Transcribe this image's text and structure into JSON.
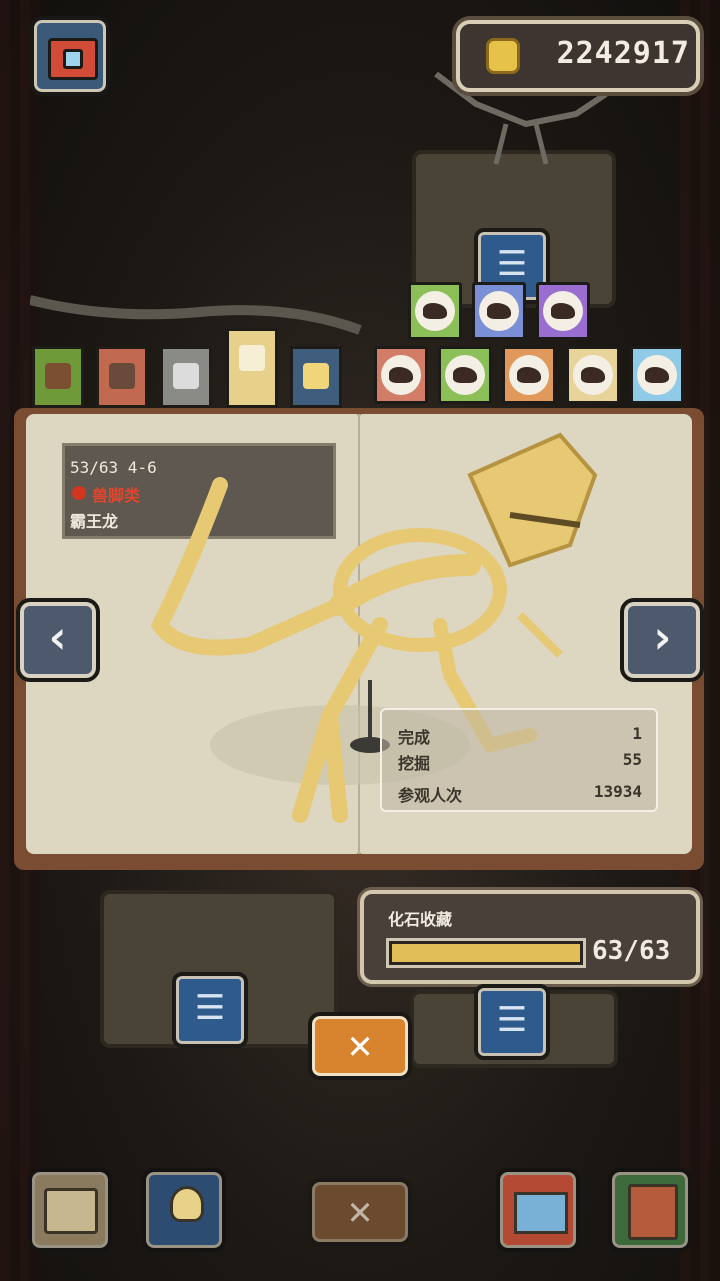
{
  "currency": {
    "amount": "2242917",
    "icon": "coin-icon"
  },
  "category_tabs": [
    {
      "name": "tab-wood",
      "color": "#6f9a3a",
      "inner": "#7a5030"
    },
    {
      "name": "tab-clay",
      "color": "#c26a50",
      "inner": "#6a4a3a"
    },
    {
      "name": "tab-stone",
      "color": "#8a8a86",
      "inner": "#dcdcdc"
    },
    {
      "name": "tab-gold",
      "color": "#e6d08a",
      "inner": "#f6efd6"
    },
    {
      "name": "tab-blue",
      "color": "#3f5e7e",
      "inner": "#f0d57a"
    }
  ],
  "dino_icons_top": [
    {
      "name": "sauropod-icon",
      "bg": "#8cbf58"
    },
    {
      "name": "plesiosaur-icon",
      "bg": "#7b8fd6"
    },
    {
      "name": "ammonite-icon",
      "bg": "#9a6ed0"
    }
  ],
  "dino_icons_bottom": [
    {
      "name": "theropod-icon",
      "bg": "#d17d68"
    },
    {
      "name": "ornithopod-icon",
      "bg": "#8cbf58"
    },
    {
      "name": "stegosaur-icon",
      "bg": "#e0995a"
    },
    {
      "name": "ceratopsian-icon",
      "bg": "#e8d49a"
    },
    {
      "name": "pterosaur-icon",
      "bg": "#8fcbe6"
    }
  ],
  "specimen": {
    "progress": "53/63  4-6",
    "category": "兽脚类",
    "name": "霸王龙"
  },
  "stats": {
    "completed_label": "完成",
    "completed_value": "1",
    "excavated_label": "挖掘",
    "excavated_value": "55",
    "visitors_label": "参观人次",
    "visitors_value": "13934"
  },
  "collection": {
    "title": "化石收藏",
    "count": "63/63",
    "progress_fraction": 1.0
  },
  "buttons": {
    "prev": "‹",
    "next": "›",
    "close": "✕",
    "list": "☰"
  },
  "colors": {
    "accent_orange": "#d8832e",
    "bar_gold": "#e2be58",
    "category_red": "#d2361f"
  }
}
